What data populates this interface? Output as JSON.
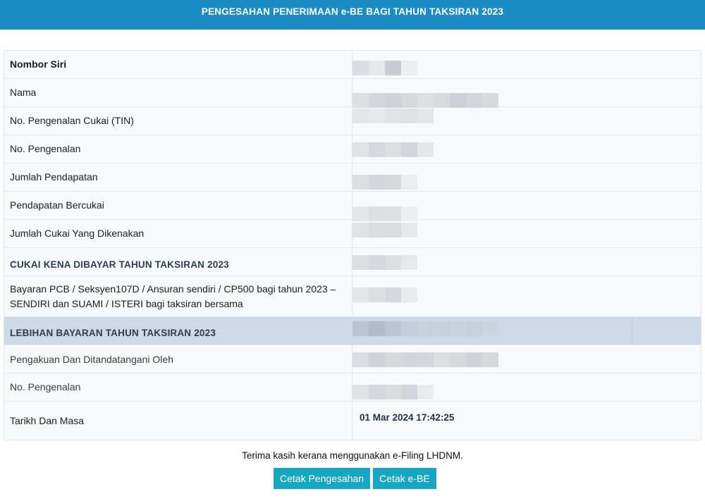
{
  "header": {
    "title": "PENGESAHAN PENERIMAAN e-BE BAGI TAHUN TAKSIRAN 2023"
  },
  "rows": [
    {
      "label": "Nombor Siri"
    },
    {
      "label": "Nama"
    },
    {
      "label": "No. Pengenalan Cukai (TIN)"
    },
    {
      "label": "No. Pengenalan"
    },
    {
      "label": "Jumlah Pendapatan"
    },
    {
      "label": "Pendapatan Bercukai"
    },
    {
      "label": "Jumlah Cukai Yang Dikenakan"
    },
    {
      "label": "CUKAI KENA DIBAYAR TAHUN TAKSIRAN 2023"
    },
    {
      "label": "Bayaran PCB / Seksyen107D / Ansuran sendiri / CP500 bagi tahun 2023 – SENDIRI dan SUAMI / ISTERI bagi taksiran bersama"
    },
    {
      "label": "LEBIHAN BAYARAN TAHUN TAKSIRAN 2023"
    },
    {
      "label": "Pengakuan Dan Ditandatangani Oleh"
    },
    {
      "label": "No. Pengenalan"
    },
    {
      "label": "Tarikh Dan Masa",
      "value": "01 Mar 2024 17:42:25"
    }
  ],
  "footer": {
    "thanks": "Terima kasih kerana menggunakan e-Filing LHDNM.",
    "print_confirmation_label": "Cetak Pengesahan",
    "print_ebe_label": "Cetak e-BE"
  }
}
